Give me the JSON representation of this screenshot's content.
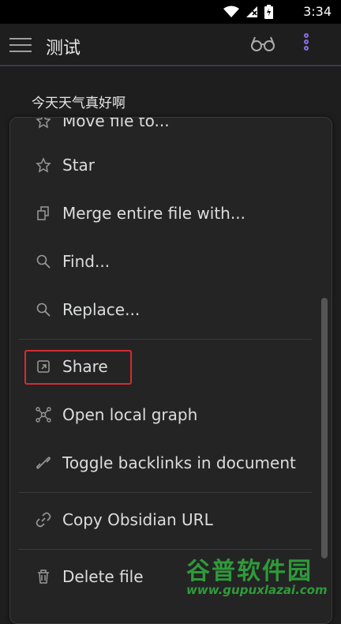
{
  "status_bar": {
    "time": "3:34"
  },
  "header": {
    "title": "测试"
  },
  "document": {
    "text": "今天天气真好啊"
  },
  "menu": {
    "items": [
      {
        "label": "Move file to...",
        "icon": "move-file-icon"
      },
      {
        "label": "Star",
        "icon": "star-icon"
      },
      {
        "label": "Merge entire file with...",
        "icon": "merge-icon"
      },
      {
        "label": "Find...",
        "icon": "search-icon"
      },
      {
        "label": "Replace...",
        "icon": "search-icon"
      },
      {
        "label": "Share",
        "icon": "share-icon"
      },
      {
        "label": "Open local graph",
        "icon": "graph-icon"
      },
      {
        "label": "Toggle backlinks in document",
        "icon": "backlinks-icon"
      },
      {
        "label": "Copy Obsidian URL",
        "icon": "link-icon"
      },
      {
        "label": "Delete file",
        "icon": "trash-icon"
      }
    ]
  },
  "watermark": {
    "name": "谷普软件园",
    "url": "www.gupuxlazai.com"
  },
  "colors": {
    "accent": "#8a6ee0",
    "highlight_box": "#d12d33",
    "watermark": "#2f9a3a"
  }
}
